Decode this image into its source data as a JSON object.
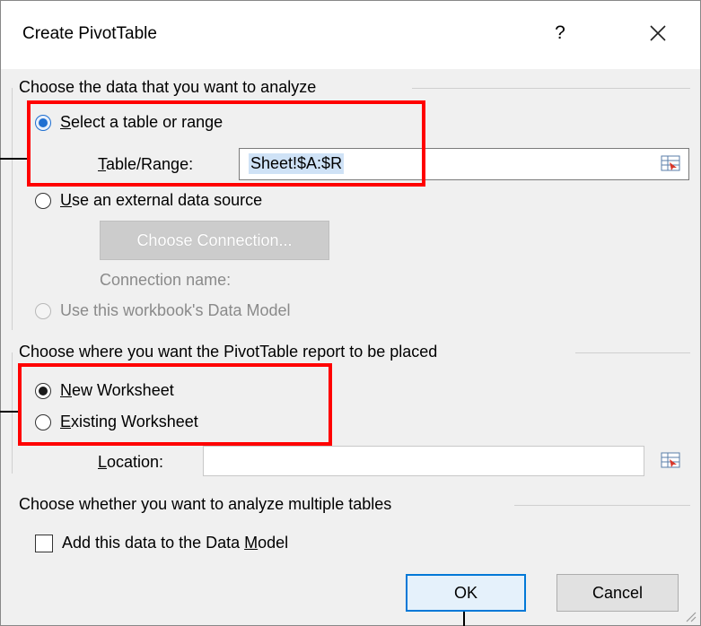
{
  "dialog": {
    "title": "Create PivotTable",
    "help_label": "?",
    "close_icon": "close-icon"
  },
  "data_section": {
    "heading": "Choose the data that you want to analyze",
    "select_range": {
      "label": "Select a table or range",
      "checked": true
    },
    "table_range": {
      "label": "Table/Range:",
      "value": "Sheet!$A:$R"
    },
    "external_source": {
      "label": "Use an external data source",
      "checked": false
    },
    "choose_connection_label": "Choose Connection...",
    "connection_name_label": "Connection name:",
    "data_model": {
      "label": "Use this workbook's Data Model",
      "enabled": false
    }
  },
  "placement_section": {
    "heading": "Choose where you want the PivotTable report to be placed",
    "new_worksheet": {
      "label": "New Worksheet",
      "checked": true
    },
    "existing_worksheet": {
      "label": "Existing Worksheet",
      "checked": false
    },
    "location": {
      "label": "Location:",
      "value": ""
    }
  },
  "multiple_section": {
    "heading": "Choose whether you want to analyze multiple tables",
    "add_to_model": {
      "label": "Add this data to the Data Model",
      "checked": false
    }
  },
  "buttons": {
    "ok": "OK",
    "cancel": "Cancel"
  },
  "colors": {
    "highlight": "#ff0000",
    "accent": "#0078d7"
  }
}
